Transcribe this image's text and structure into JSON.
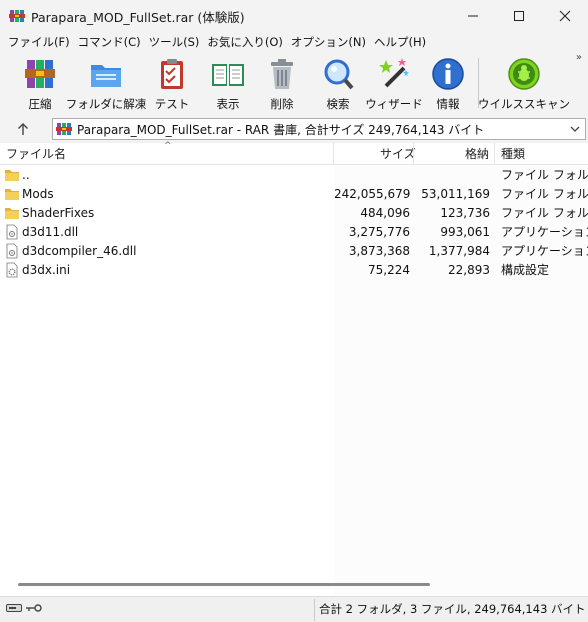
{
  "window": {
    "title": "Parapara_MOD_FullSet.rar (体験版)",
    "minimize_icon": "minimize-icon",
    "maximize_icon": "maximize-icon",
    "close_icon": "close-icon"
  },
  "menu": [
    "ファイル(F)",
    "コマンド(C)",
    "ツール(S)",
    "お気に入り(O)",
    "オプション(N)",
    "ヘルプ(H)"
  ],
  "toolbar": {
    "buttons": [
      {
        "label": "圧縮",
        "icon": "archive-books-icon"
      },
      {
        "label": "フォルダに解凍",
        "icon": "folder-extract-icon"
      },
      {
        "label": "テスト",
        "icon": "clipboard-check-icon"
      },
      {
        "label": "表示",
        "icon": "open-book-icon"
      },
      {
        "label": "削除",
        "icon": "trash-can-icon"
      },
      {
        "label": "検索",
        "icon": "magnifier-icon"
      },
      {
        "label": "ウィザード",
        "icon": "magic-wand-icon"
      },
      {
        "label": "情報",
        "icon": "info-icon"
      },
      {
        "label": "ウイルススキャン",
        "icon": "virus-scan-icon"
      }
    ],
    "more": "»"
  },
  "address": {
    "path": "Parapara_MOD_FullSet.rar - RAR 書庫, 合計サイズ 249,764,143 バイト"
  },
  "columns": {
    "name": "ファイル名",
    "size": "サイズ",
    "packed": "格納",
    "type": "種類"
  },
  "files": [
    {
      "name": "..",
      "size": "",
      "packed": "",
      "type": "ファイル フォルダー",
      "icon": "folder-icon"
    },
    {
      "name": "Mods",
      "size": "242,055,679",
      "packed": "53,011,169",
      "type": "ファイル フォルダー",
      "icon": "folder-icon"
    },
    {
      "name": "ShaderFixes",
      "size": "484,096",
      "packed": "123,736",
      "type": "ファイル フォルダー",
      "icon": "folder-icon"
    },
    {
      "name": "d3d11.dll",
      "size": "3,275,776",
      "packed": "993,061",
      "type": "アプリケーション拡張",
      "icon": "dll-file-icon"
    },
    {
      "name": "d3dcompiler_46.dll",
      "size": "3,873,368",
      "packed": "1,377,984",
      "type": "アプリケーション拡張",
      "icon": "dll-file-icon"
    },
    {
      "name": "d3dx.ini",
      "size": "75,224",
      "packed": "22,893",
      "type": "構成設定",
      "icon": "ini-file-icon"
    }
  ],
  "status": {
    "summary": "合計 2 フォルダ, 3 ファイル, 249,764,143 バイト",
    "icons": [
      "drive-icon",
      "key-icon"
    ]
  },
  "colors": {
    "folder": "#f2c94c",
    "accent_blue": "#2f6fd0",
    "virus_green": "#7ed321"
  }
}
